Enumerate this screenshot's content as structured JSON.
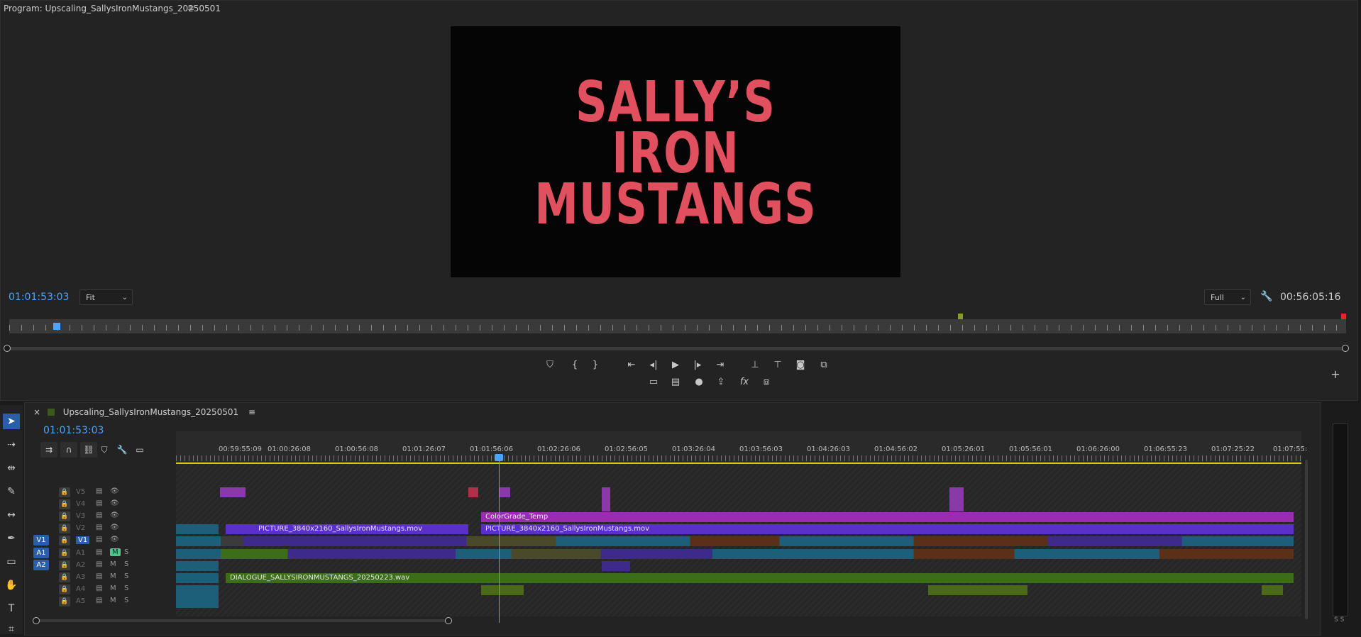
{
  "program_monitor": {
    "title": "Program: Upscaling_SallysIronMustangs_20250501",
    "menu_icon": "hamburger-icon",
    "video_title_lines": [
      "SALLY’S",
      "IRON",
      "MUSTANGS"
    ],
    "video_title_color": "#e0505e",
    "current_timecode": "01:01:53:03",
    "zoom_select": "Fit",
    "resolution_select": "Full",
    "duration_timecode": "00:56:05:16",
    "controls": [
      "add-marker-icon",
      "mark-in-icon",
      "mark-out-icon",
      "go-to-in-icon",
      "step-back-icon",
      "play-icon",
      "step-forward-icon",
      "go-to-out-icon",
      "lift-icon",
      "extract-icon",
      "export-frame-icon",
      "comparison-view-icon"
    ],
    "controls_row2": [
      "safe-margins-icon",
      "proxy-toggle-icon",
      "record-icon",
      "export-icon",
      "fx-icon",
      "multicam-icon"
    ],
    "add_button": "+"
  },
  "timeline": {
    "tab_title": "Upscaling_SallysIronMustangs_20250501",
    "close": "×",
    "menu_icon": "hamburger-icon",
    "current_timecode": "01:01:53:03",
    "ruler_labels": [
      "00:59:55:09",
      "01:00:26:08",
      "01:00:56:08",
      "01:01:26:07",
      "01:01:56:06",
      "01:02:26:06",
      "01:02:56:05",
      "01:03:26:04",
      "01:03:56:03",
      "01:04:26:03",
      "01:04:56:02",
      "01:05:26:01",
      "01:05:56:01",
      "01:06:26:00",
      "01:06:55:23",
      "01:07:25:22",
      "01:07:55:"
    ],
    "tracks": [
      {
        "name": "V5",
        "type": "video"
      },
      {
        "name": "V4",
        "type": "video"
      },
      {
        "name": "V3",
        "type": "video"
      },
      {
        "name": "V2",
        "type": "video"
      },
      {
        "name": "V1",
        "type": "video",
        "source": "V1"
      },
      {
        "name": "A1",
        "type": "audio",
        "source": "A1",
        "mute": "M",
        "solo": "S"
      },
      {
        "name": "A2",
        "type": "audio",
        "source": "A2",
        "mute": "M",
        "solo": "S"
      },
      {
        "name": "A3",
        "type": "audio",
        "mute": "M",
        "solo": "S"
      },
      {
        "name": "A4",
        "type": "audio",
        "mute": "M",
        "solo": "S"
      },
      {
        "name": "A5",
        "type": "audio",
        "mute": "M",
        "solo": "S"
      }
    ],
    "clips": {
      "colorgrade": "ColorGrade_Temp",
      "picture_a": "PICTURE_3840x2160_SallysIronMustangs.mov",
      "picture_b": "PICTURE_3840x2160_SallysIronMustangs.mov",
      "dialogue": "DIALOGUE_SALLYSIRONMUSTANGS_20250223.wav",
      "fx": "fx"
    },
    "colors": {
      "video_clip": "#5b2fc9",
      "colorgrade_clip": "#9b2bb0",
      "audio_clip": "#3c6e1a",
      "playhead": "#4ea3ff"
    }
  },
  "tools": [
    "selection-tool-icon",
    "track-select-tool-icon",
    "ripple-edit-tool-icon",
    "razor-tool-icon",
    "slip-tool-icon",
    "pen-tool-icon",
    "rectangle-tool-icon",
    "hand-tool-icon",
    "type-tool-icon",
    "caption-tool-icon"
  ],
  "meter": {
    "labels": "S S"
  }
}
